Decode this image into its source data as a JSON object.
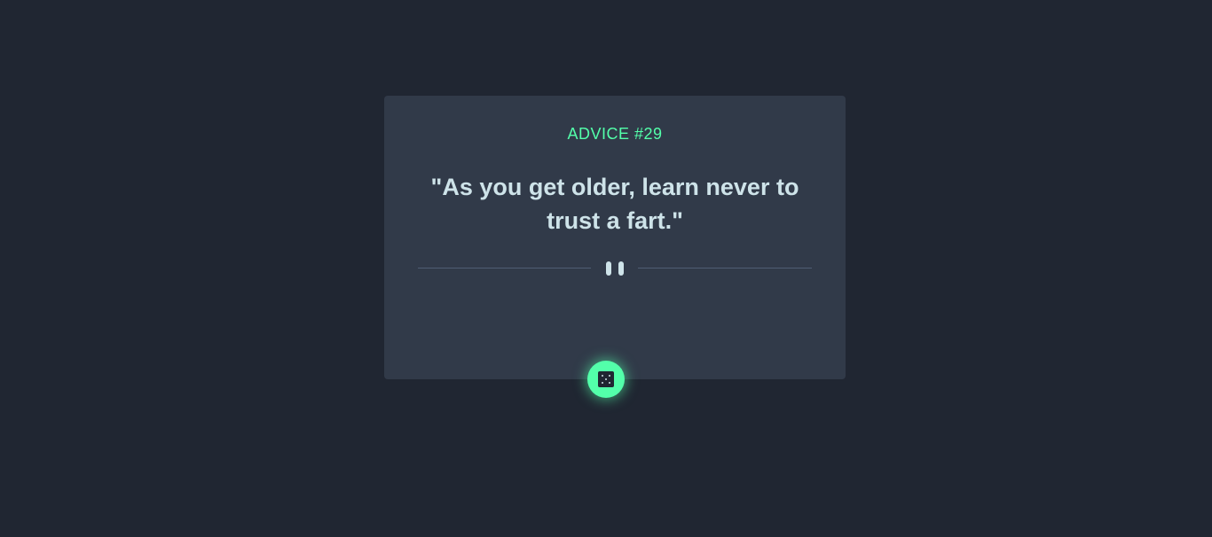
{
  "card": {
    "advice_label": "ADVICE #29",
    "quote": "\"As you get older, learn never to trust a fart.\""
  },
  "divider": {
    "icon": "pause-icon"
  },
  "dice_button": {
    "icon": "dice-icon"
  },
  "colors": {
    "background": "#202632",
    "card": "#313a49",
    "accent": "#53ffaa",
    "text": "#cee3e9",
    "divider": "#4f5d74"
  }
}
